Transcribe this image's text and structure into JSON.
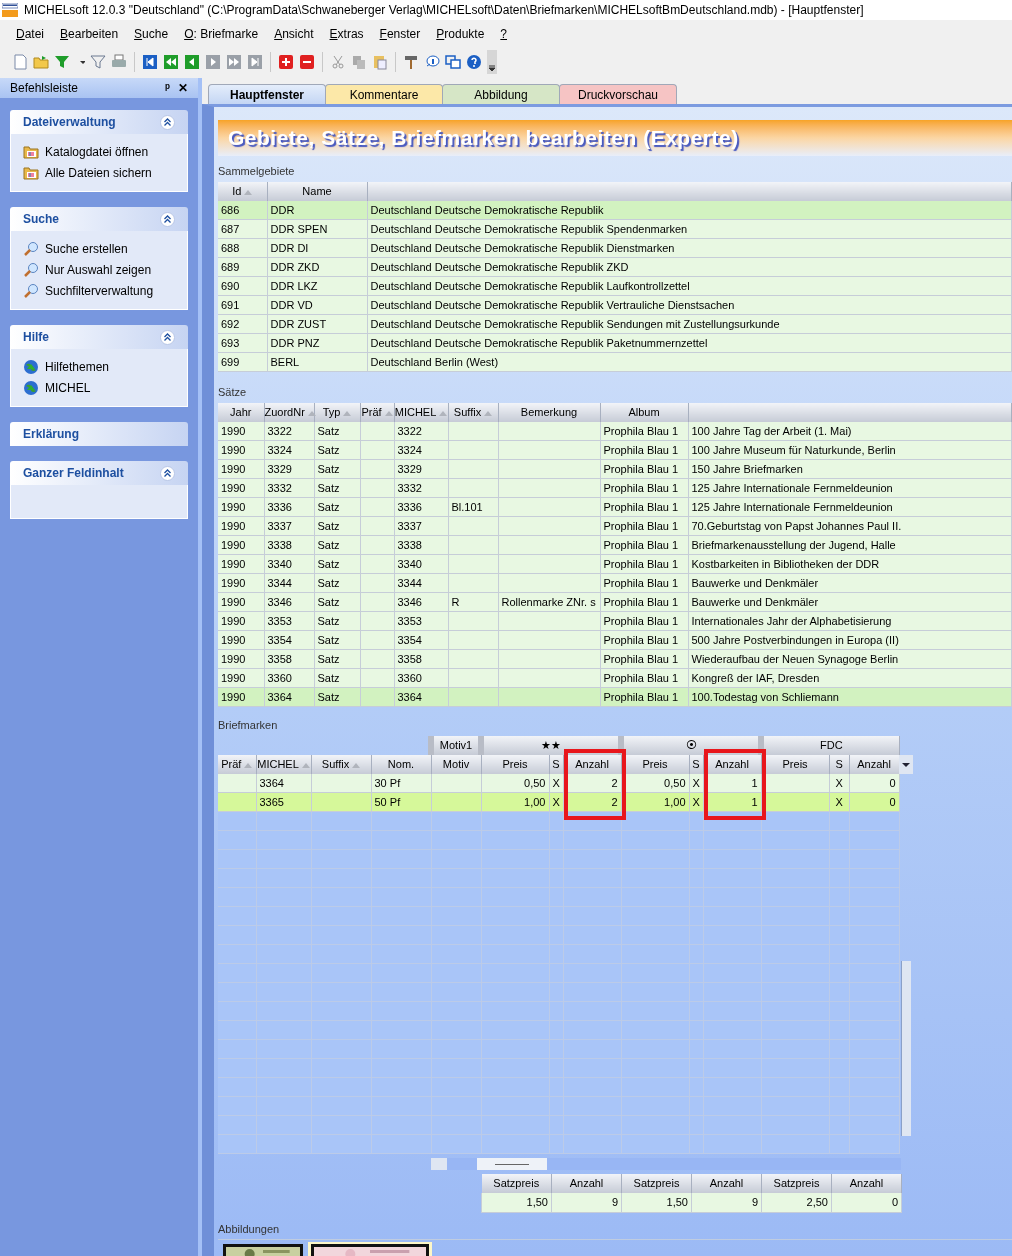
{
  "window": {
    "title": "MICHELsoft 12.0.3 \"Deutschland\" (C:\\ProgramData\\Schwaneberger Verlag\\MICHELsoft\\Daten\\Briefmarken\\MICHELsoftBmDeutschland.mdb) - [Hauptfenster]"
  },
  "menu": [
    "Datei",
    "Bearbeiten",
    "Suche",
    "O: Briefmarke",
    "Ansicht",
    "Extras",
    "Fenster",
    "Produkte",
    "?"
  ],
  "sidebar": {
    "title": "Befehlsleiste",
    "pin": "ᵖ",
    "close": "✕",
    "groups": [
      {
        "title": "Dateiverwaltung",
        "expanded": true,
        "items": [
          {
            "label": "Katalogdatei öffnen",
            "kind": "folder"
          },
          {
            "label": "Alle Dateien sichern",
            "kind": "folder"
          }
        ]
      },
      {
        "title": "Suche",
        "expanded": true,
        "items": [
          {
            "label": "Suche erstellen",
            "kind": "search"
          },
          {
            "label": "Nur Auswahl zeigen",
            "kind": "search"
          },
          {
            "label": "Suchfilterverwaltung",
            "kind": "search"
          }
        ]
      },
      {
        "title": "Hilfe",
        "expanded": true,
        "items": [
          {
            "label": "Hilfethemen",
            "kind": "globe"
          },
          {
            "label": "MICHEL",
            "kind": "globe"
          }
        ]
      },
      {
        "title": "Erklärung",
        "expanded": false
      },
      {
        "title": "Ganzer Feldinhalt",
        "expanded": true
      }
    ]
  },
  "tabs": [
    {
      "label": "Hauptfenster",
      "selected": true,
      "color": "#c4d6f4"
    },
    {
      "label": "Kommentare",
      "selected": false,
      "color": "#fce8a8"
    },
    {
      "label": "Abbildung",
      "selected": false,
      "color": "#d6e6c6"
    },
    {
      "label": "Druckvorschau",
      "selected": false,
      "color": "#f6c4c4"
    }
  ],
  "banner": "Gebiete, Sätze, Briefmarken bearbeiten (Experte)",
  "sammelgebiete": {
    "label": "Sammelgebiete",
    "columns": [
      {
        "label": "Id",
        "sorted": true
      },
      {
        "label": "Name",
        "sorted": false
      }
    ],
    "rows": [
      {
        "id": "686",
        "name": "DDR",
        "title": "Deutschland Deutsche Demokratische Republik",
        "selected": true
      },
      {
        "id": "687",
        "name": "DDR SPEN",
        "title": "Deutschland Deutsche Demokratische Republik Spendenmarken",
        "selected": false
      },
      {
        "id": "688",
        "name": "DDR DI",
        "title": "Deutschland Deutsche Demokratische Republik Dienstmarken",
        "selected": false
      },
      {
        "id": "689",
        "name": "DDR ZKD",
        "title": "Deutschland Deutsche Demokratische Republik ZKD",
        "selected": false
      },
      {
        "id": "690",
        "name": "DDR LKZ",
        "title": "Deutschland Deutsche Demokratische Republik Laufkontrollzettel",
        "selected": false
      },
      {
        "id": "691",
        "name": "DDR VD",
        "title": "Deutschland Deutsche Demokratische Republik Vertrauliche Dienstsachen",
        "selected": false
      },
      {
        "id": "692",
        "name": "DDR ZUST",
        "title": "Deutschland Deutsche Demokratische Republik Sendungen mit Zustellungsurkunde",
        "selected": false
      },
      {
        "id": "693",
        "name": "DDR PNZ",
        "title": "Deutschland Deutsche Demokratische Republik Paketnummernzettel",
        "selected": false
      },
      {
        "id": "699",
        "name": "BERL",
        "title": "Deutschland Berlin (West)",
        "selected": false
      }
    ]
  },
  "saetze": {
    "label": "Sätze",
    "columns": [
      {
        "label": "Jahr",
        "sorted": false
      },
      {
        "label": "ZuordNr",
        "sorted": true
      },
      {
        "label": "Typ",
        "sorted": true
      },
      {
        "label": "Präf",
        "sorted": true
      },
      {
        "label": "MICHEL",
        "sorted": true
      },
      {
        "label": "Suffix",
        "sorted": true
      },
      {
        "label": "Bemerkung",
        "sorted": false
      },
      {
        "label": "Album",
        "sorted": false
      }
    ],
    "rows": [
      {
        "cells": [
          "1990",
          "3322",
          "Satz",
          "",
          "3322",
          "",
          "",
          "Prophila Blau 1",
          "100 Jahre Tag der Arbeit (1. Mai)"
        ],
        "selected": false
      },
      {
        "cells": [
          "1990",
          "3324",
          "Satz",
          "",
          "3324",
          "",
          "",
          "Prophila Blau 1",
          "100 Jahre Museum für Naturkunde, Berlin"
        ],
        "selected": false
      },
      {
        "cells": [
          "1990",
          "3329",
          "Satz",
          "",
          "3329",
          "",
          "",
          "Prophila Blau 1",
          "150 Jahre Briefmarken"
        ],
        "selected": false
      },
      {
        "cells": [
          "1990",
          "3332",
          "Satz",
          "",
          "3332",
          "",
          "",
          "Prophila Blau 1",
          "125 Jahre Internationale Fernmeldeunion"
        ],
        "selected": false
      },
      {
        "cells": [
          "1990",
          "3336",
          "Satz",
          "",
          "3336",
          "Bl.101",
          "",
          "Prophila Blau 1",
          "125 Jahre Internationale Fernmeldeunion"
        ],
        "selected": false
      },
      {
        "cells": [
          "1990",
          "3337",
          "Satz",
          "",
          "3337",
          "",
          "",
          "Prophila Blau 1",
          "70.Geburtstag von Papst Johannes Paul II."
        ],
        "selected": false
      },
      {
        "cells": [
          "1990",
          "3338",
          "Satz",
          "",
          "3338",
          "",
          "",
          "Prophila Blau 1",
          "Briefmarkenausstellung der Jugend, Halle"
        ],
        "selected": false
      },
      {
        "cells": [
          "1990",
          "3340",
          "Satz",
          "",
          "3340",
          "",
          "",
          "Prophila Blau 1",
          "Kostbarkeiten in Bibliotheken der DDR"
        ],
        "selected": false
      },
      {
        "cells": [
          "1990",
          "3344",
          "Satz",
          "",
          "3344",
          "",
          "",
          "Prophila Blau 1",
          "Bauwerke und Denkmäler"
        ],
        "selected": false
      },
      {
        "cells": [
          "1990",
          "3346",
          "Satz",
          "",
          "3346",
          "R",
          "Rollenmarke ZNr. s",
          "Prophila Blau 1",
          "Bauwerke und Denkmäler"
        ],
        "selected": false
      },
      {
        "cells": [
          "1990",
          "3353",
          "Satz",
          "",
          "3353",
          "",
          "",
          "Prophila Blau 1",
          "Internationales Jahr der Alphabetisierung"
        ],
        "selected": false
      },
      {
        "cells": [
          "1990",
          "3354",
          "Satz",
          "",
          "3354",
          "",
          "",
          "Prophila Blau 1",
          "500 Jahre Postverbindungen in Europa (II)"
        ],
        "selected": false
      },
      {
        "cells": [
          "1990",
          "3358",
          "Satz",
          "",
          "3358",
          "",
          "",
          "Prophila Blau 1",
          "Wiederaufbau der Neuen Synagoge Berlin"
        ],
        "selected": false
      },
      {
        "cells": [
          "1990",
          "3360",
          "Satz",
          "",
          "3360",
          "",
          "",
          "Prophila Blau 1",
          "Kongreß der IAF, Dresden"
        ],
        "selected": false
      },
      {
        "cells": [
          "1990",
          "3364",
          "Satz",
          "",
          "3364",
          "",
          "",
          "Prophila Blau 1",
          "100.Todestag von Schliemann"
        ],
        "selected": true
      }
    ]
  },
  "briefmarken": {
    "label": "Briefmarken",
    "groups": [
      {
        "label": "Motiv1"
      },
      {
        "label": "★★"
      },
      {
        "label": "⦿"
      },
      {
        "label": "FDC"
      }
    ],
    "columns": [
      {
        "label": "Präf",
        "sorted": true,
        "highlighted": false
      },
      {
        "label": "MICHEL",
        "sorted": true,
        "highlighted": false
      },
      {
        "label": "Suffix",
        "sorted": true,
        "highlighted": false
      },
      {
        "label": "Nom.",
        "sorted": false,
        "highlighted": false
      },
      {
        "label": "Motiv",
        "sorted": false,
        "highlighted": false
      },
      {
        "label": "Preis",
        "sorted": false,
        "highlighted": false
      },
      {
        "label": "S",
        "sorted": false,
        "highlighted": false
      },
      {
        "label": "Anzahl",
        "sorted": false,
        "highlighted": true
      },
      {
        "label": "Preis",
        "sorted": false,
        "highlighted": false
      },
      {
        "label": "S",
        "sorted": false,
        "highlighted": false
      },
      {
        "label": "Anzahl",
        "sorted": false,
        "highlighted": true
      },
      {
        "label": "Preis",
        "sorted": false,
        "highlighted": false
      },
      {
        "label": "S",
        "sorted": false,
        "highlighted": false
      },
      {
        "label": "Anzahl",
        "sorted": false,
        "highlighted": false
      }
    ],
    "rows": [
      {
        "cells": [
          "",
          "3364",
          "",
          "30 Pf",
          "",
          "0,50",
          "X",
          "2",
          "0,50",
          "X",
          "1",
          "",
          "X",
          "0"
        ],
        "selected": false
      },
      {
        "cells": [
          "",
          "3365",
          "",
          "50 Pf",
          "",
          "1,00",
          "X",
          "2",
          "1,00",
          "X",
          "1",
          "",
          "X",
          "0"
        ],
        "selected": true
      }
    ],
    "totals": {
      "columns": [
        "Satzpreis",
        "Anzahl",
        "Satzpreis",
        "Anzahl",
        "Satzpreis",
        "Anzahl"
      ],
      "values": [
        "1,50",
        "9",
        "1,50",
        "9",
        "2,50",
        "0"
      ]
    }
  },
  "abbildungen": {
    "label": "Abbildungen",
    "images": [
      {
        "selected": false
      },
      {
        "selected": true
      }
    ]
  }
}
